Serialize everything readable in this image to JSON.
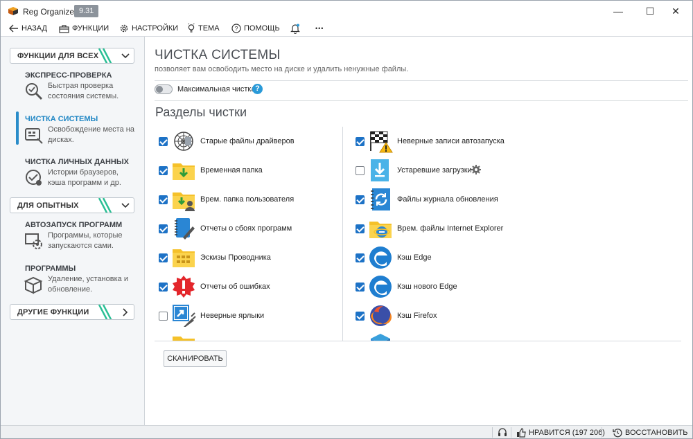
{
  "window": {
    "app_title": "Reg Organizer",
    "version": "9.31",
    "controls": {
      "minimize": "—",
      "maximize": "☐",
      "close": "✕"
    }
  },
  "toolbar": {
    "back": "НАЗАД",
    "functions": "ФУНКЦИИ",
    "settings": "НАСТРОЙКИ",
    "theme": "ТЕМА",
    "help": "ПОМОЩЬ",
    "more": "•••"
  },
  "sidebar": {
    "group_all": "ФУНКЦИИ ДЛЯ ВСЕХ",
    "express": {
      "title": "ЭКСПРЕСС-ПРОВЕРКА",
      "desc": "Быстрая проверка состояния системы."
    },
    "cleanup": {
      "title": "ЧИСТКА СИСТЕМЫ",
      "desc": "Освобождение места на дисках."
    },
    "privacy": {
      "title": "ЧИСТКА ЛИЧНЫХ ДАННЫХ",
      "desc": "Истории браузеров, кэша программ и др."
    },
    "group_advanced": "ДЛЯ ОПЫТНЫХ",
    "autorun": {
      "title": "АВТОЗАПУСК ПРОГРАММ",
      "desc": "Программы, которые запускаются сами."
    },
    "programs": {
      "title": "ПРОГРАММЫ",
      "desc": "Удаление, установка и обновление."
    },
    "group_other": "ДРУГИЕ ФУНКЦИИ"
  },
  "main": {
    "title": "ЧИСТКА СИСТЕМЫ",
    "subtitle": "позволяет вам освободить место на диске и удалить ненужные файлы.",
    "max_clean_label": "Максимальная чистка",
    "max_clean_enabled": false,
    "sections_title": "Разделы чистки",
    "scan_button": "СКАНИРОВАТЬ",
    "left_items": [
      {
        "label": "Старые файлы драйверов",
        "checked": true,
        "icon": "driver-web-icon"
      },
      {
        "label": "Временная папка",
        "checked": true,
        "icon": "temp-folder-icon"
      },
      {
        "label": "Врем. папка пользователя",
        "checked": true,
        "icon": "user-temp-folder-icon"
      },
      {
        "label": "Отчеты о сбоях программ",
        "checked": true,
        "icon": "crash-report-notebook-icon"
      },
      {
        "label": "Эскизы Проводника",
        "checked": true,
        "icon": "thumbnails-folder-icon"
      },
      {
        "label": "Отчеты об ошибках",
        "checked": true,
        "icon": "error-report-icon"
      },
      {
        "label": "Неверные ярлыки",
        "checked": false,
        "icon": "broken-shortcut-icon"
      }
    ],
    "right_items": [
      {
        "label": "Неверные записи автозапуска",
        "checked": true,
        "icon": "autorun-flag-warning-icon"
      },
      {
        "label": "Устаревшие загрузки",
        "checked": false,
        "icon": "downloads-icon",
        "has_settings": true
      },
      {
        "label": "Файлы журнала обновления",
        "checked": true,
        "icon": "update-log-icon"
      },
      {
        "label": "Врем. файлы Internet Explorer",
        "checked": true,
        "icon": "ie-folder-icon"
      },
      {
        "label": "Кэш Edge",
        "checked": true,
        "icon": "edge-icon"
      },
      {
        "label": "Кэш нового Edge",
        "checked": true,
        "icon": "new-edge-icon"
      },
      {
        "label": "Кэш Firefox",
        "checked": true,
        "icon": "firefox-icon"
      }
    ]
  },
  "statusbar": {
    "likes": "НРАВИТСЯ (197 206)",
    "restore": "ВОССТАНОВИТЬ"
  },
  "colors": {
    "accent": "#1f86c4",
    "checkbox": "#1d72c6",
    "sidebar_bg": "#f4f6f8",
    "folder_yellow": "#f5c12a"
  }
}
